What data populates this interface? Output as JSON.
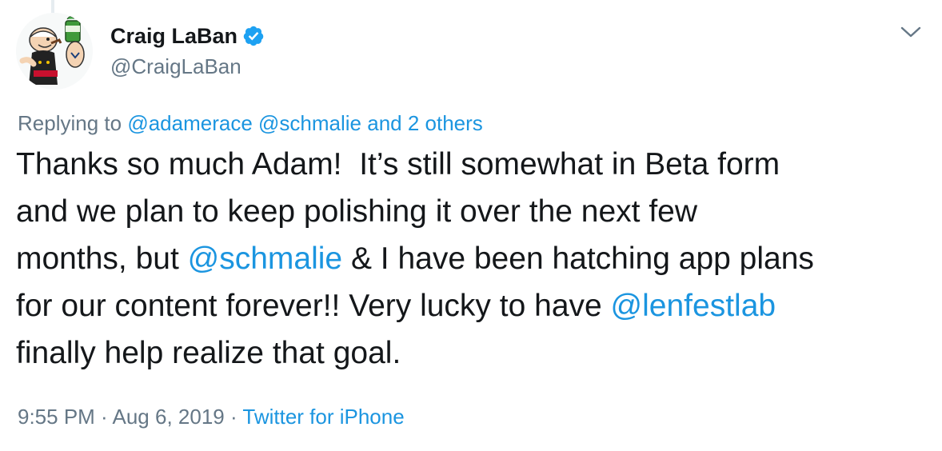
{
  "author": {
    "display_name": "Craig LaBan",
    "handle": "@CraigLaBan",
    "verified": true,
    "avatar_icon": "popeye-avatar-icon"
  },
  "reply": {
    "prefix": "Replying to ",
    "mentions": [
      "@adamerace",
      "@schmalie"
    ],
    "others": "and 2 others"
  },
  "body": {
    "segments": [
      {
        "text": "Thanks so much Adam!  It’s still somewhat in Beta form\nand we plan to keep polishing it over the next few\nmonths, but ",
        "link": false
      },
      {
        "text": "@schmalie",
        "link": true
      },
      {
        "text": " & I have been hatching app plans\nfor our content forever!! Very lucky to have ",
        "link": false
      },
      {
        "text": "@lenfestlab",
        "link": true
      },
      {
        "text": "\nfinally help realize that goal.",
        "link": false
      }
    ]
  },
  "meta": {
    "time": "9:55 PM",
    "separator": " · ",
    "date": "Aug 6, 2019",
    "source": "Twitter for iPhone"
  },
  "colors": {
    "link": "#1b95e0",
    "text": "#14171a",
    "secondary": "#657786",
    "verified_badge": "#1da1f2"
  },
  "caret_icon": "chevron-down-icon"
}
